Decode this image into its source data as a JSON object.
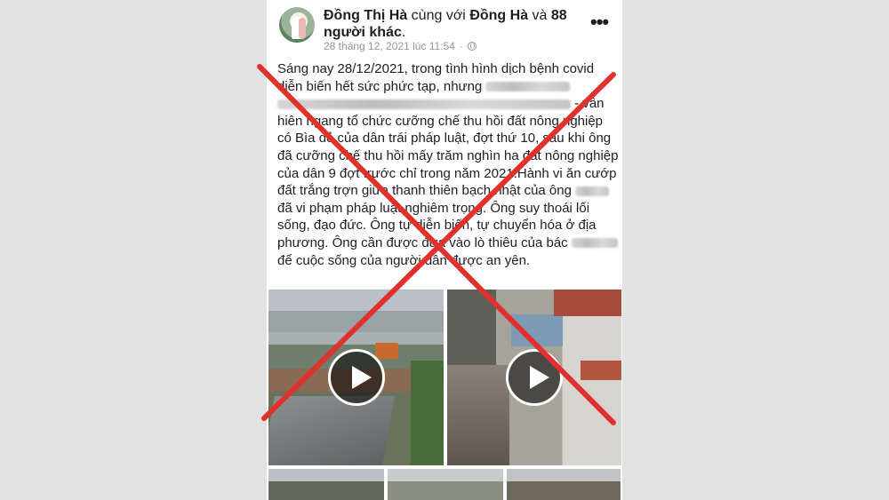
{
  "post": {
    "author": "Đồng Thị Hà",
    "with_word": "cùng với",
    "tagged_user": "Đồng Hà",
    "and_word": "và",
    "others": "88 người khác",
    "period": ".",
    "timestamp": "28 tháng 12, 2021 lúc 11:54",
    "separator": "·",
    "more_label": "•••",
    "body": {
      "p1": "Sáng nay 28/12/2021, trong tình hình dịch bệnh covid diễn biến hết sức phức tạp, nhưng ",
      "p2": "- vẫn hiên ngang tổ chức cưỡng chế thu hồi đất nông nghiệp có Bìa đỏ của dân trái pháp luật, đợt thứ 10, sau khi ông đã cưỡng chế thu hồi mấy trăm nghìn ha đất nông nghiệp của dân 9 đợt trước chỉ trong năm 2021.Hành vi ăn cướp đất trắng trợn giữa thanh thiên bạch nhật của ông ",
      "p3": " đã vi phạm pháp luật nghiêm trọng. Ông suy thoái lối sống, đạo đức. Ông tự diễn biến, tự chuyển hóa ở địa phương. Ông cần được đưa vào lò thiêu của bác ",
      "p4": " để cuộc sống của người dân được an yên."
    }
  },
  "icons": {
    "privacy": "globe-icon",
    "play": "play-icon",
    "overlay": "red-x-mark"
  },
  "colors": {
    "cross": "#e0312f",
    "meta_text": "#90949c",
    "text": "#1c1e21"
  }
}
